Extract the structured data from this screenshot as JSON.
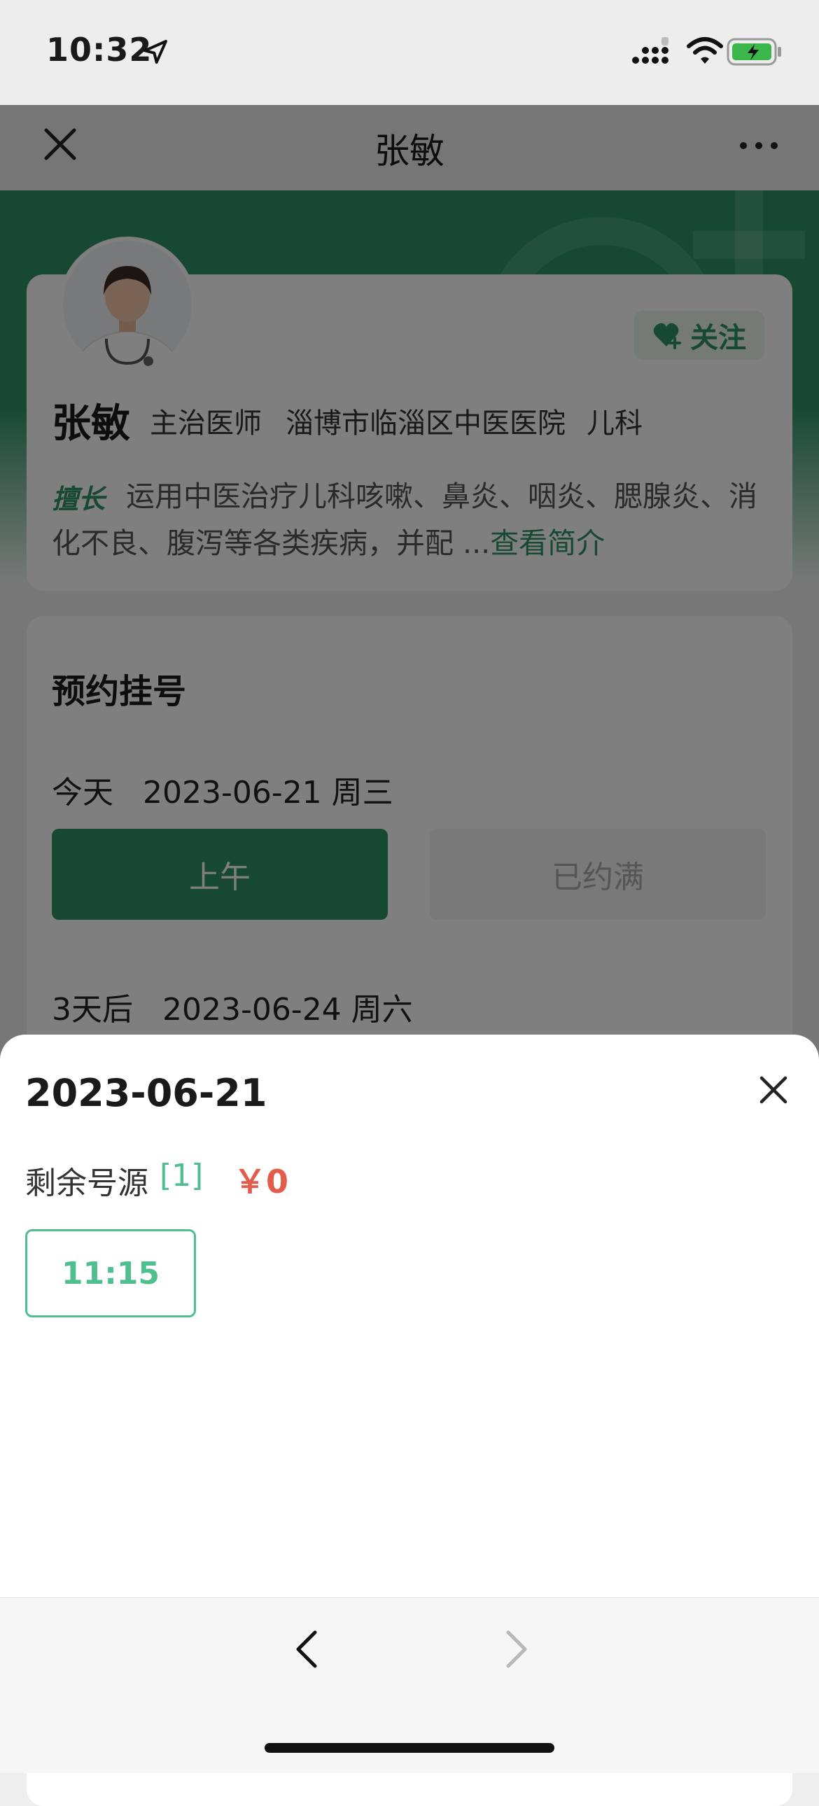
{
  "status_bar": {
    "time": "10:32"
  },
  "nav": {
    "title": "张敏"
  },
  "doctor": {
    "name": "张敏",
    "title": "主治医师",
    "hospital": "淄博市临淄区中医医院",
    "department": "儿科",
    "follow_label": "关注",
    "specialty_badge": "擅长",
    "specialty_text": "运用中医治疗儿科咳嗽、鼻炎、咽炎、腮腺炎、消化不良、腹泻等各类疾病，并配 ...",
    "profile_link": "查看简介"
  },
  "booking": {
    "title": "预约挂号",
    "days": [
      {
        "relative": "今天",
        "date": "2023-06-21 周三",
        "slots": [
          "上午",
          "已约满"
        ]
      },
      {
        "relative": "3天后",
        "date": "2023-06-24 周六"
      }
    ]
  },
  "sheet": {
    "date": "2023-06-21",
    "remain_label": "剩余号源",
    "remain_count": "[1]",
    "price": "￥0",
    "time_slots": [
      "11:15"
    ]
  },
  "colors": {
    "brand_green": "#2e9168",
    "accent_green": "#4fbf8f",
    "price_red": "#e25b4b"
  }
}
